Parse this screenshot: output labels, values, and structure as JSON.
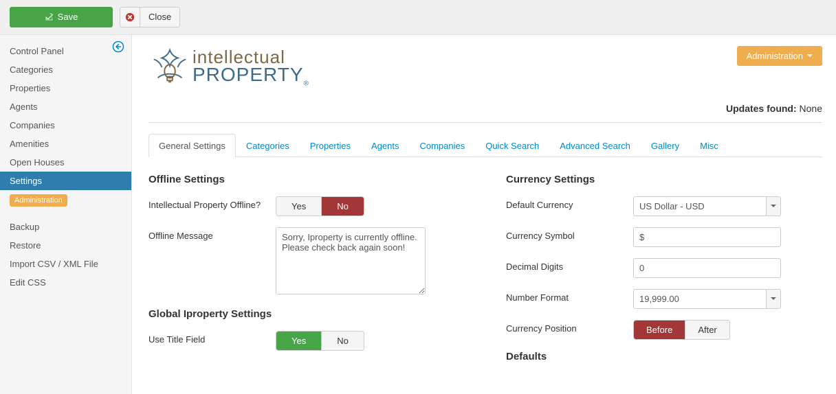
{
  "toolbar": {
    "save_label": "Save",
    "close_label": "Close"
  },
  "sidebar": {
    "items": [
      {
        "label": "Control Panel"
      },
      {
        "label": "Categories"
      },
      {
        "label": "Properties"
      },
      {
        "label": "Agents"
      },
      {
        "label": "Companies"
      },
      {
        "label": "Amenities"
      },
      {
        "label": "Open Houses"
      },
      {
        "label": "Settings",
        "active": true
      }
    ],
    "badge": "Administration",
    "admin_items": [
      {
        "label": "Backup"
      },
      {
        "label": "Restore"
      },
      {
        "label": "Import CSV / XML File"
      },
      {
        "label": "Edit CSS"
      }
    ]
  },
  "logo": {
    "line1": "intellectual",
    "line2": "PROPERTY"
  },
  "admin_button": "Administration",
  "updates": {
    "label": "Updates found:",
    "value": "None"
  },
  "tabs": [
    {
      "label": "General Settings",
      "active": true
    },
    {
      "label": "Categories"
    },
    {
      "label": "Properties"
    },
    {
      "label": "Agents"
    },
    {
      "label": "Companies"
    },
    {
      "label": "Quick Search"
    },
    {
      "label": "Advanced Search"
    },
    {
      "label": "Gallery"
    },
    {
      "label": "Misc"
    }
  ],
  "left": {
    "offline_heading": "Offline Settings",
    "offline_label": "Intellectual Property Offline?",
    "yes": "Yes",
    "no": "No",
    "offline_msg_label": "Offline Message",
    "offline_msg_value": "Sorry, Iproperty is currently offline. Please check back again soon!",
    "global_heading": "Global Iproperty Settings",
    "use_title_label": "Use Title Field"
  },
  "right": {
    "currency_heading": "Currency Settings",
    "default_currency_label": "Default Currency",
    "default_currency_value": "US Dollar - USD",
    "currency_symbol_label": "Currency Symbol",
    "currency_symbol_value": "$",
    "decimal_digits_label": "Decimal Digits",
    "decimal_digits_value": "0",
    "number_format_label": "Number Format",
    "number_format_value": "19,999.00",
    "currency_position_label": "Currency Position",
    "before": "Before",
    "after": "After",
    "defaults_heading": "Defaults"
  }
}
